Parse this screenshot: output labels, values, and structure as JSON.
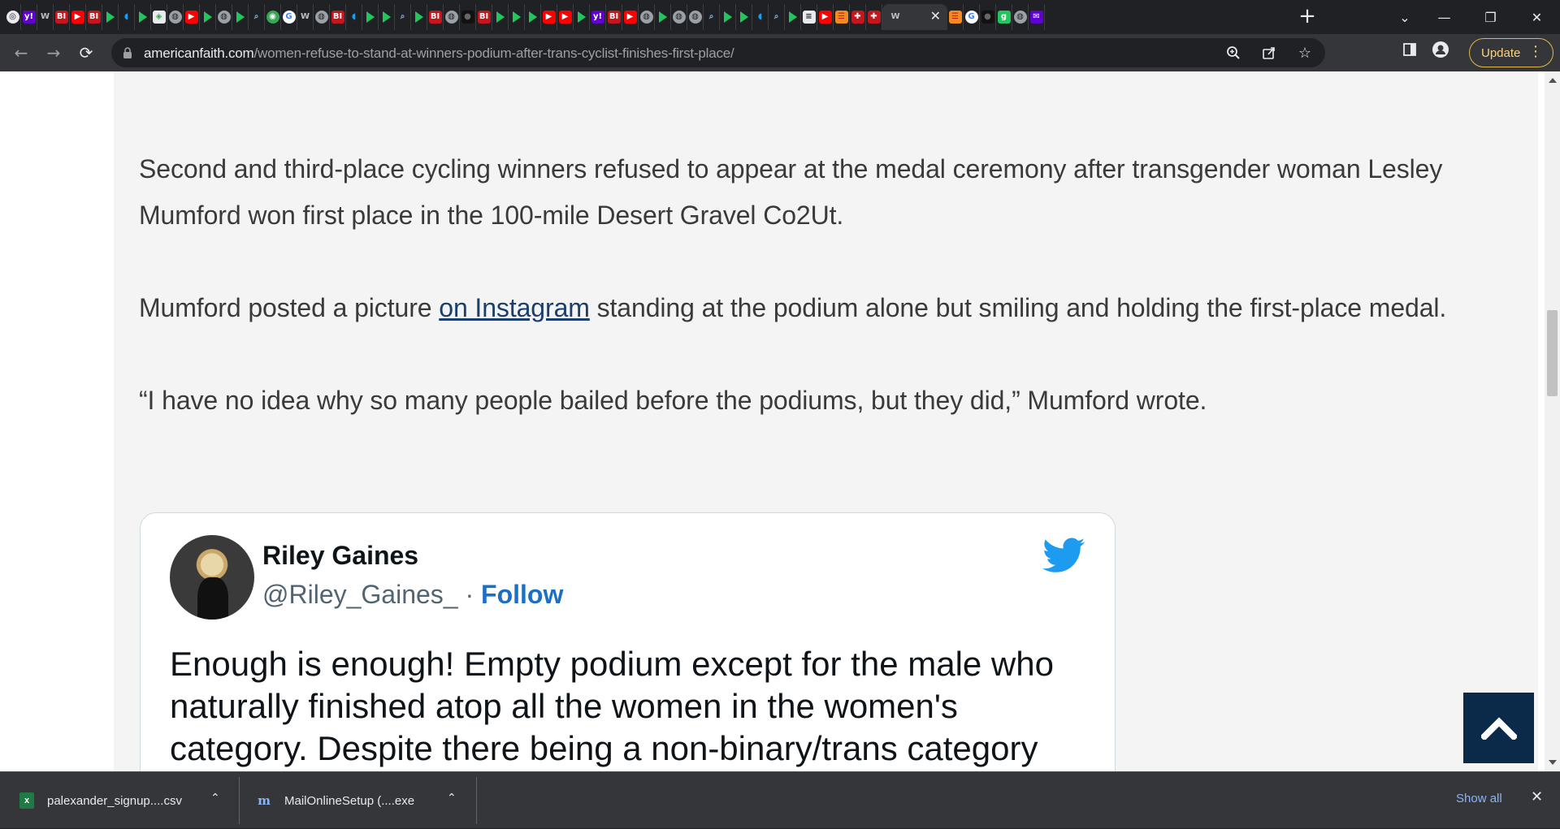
{
  "browser": {
    "tab_favicons": [
      "chrome",
      "yahoo",
      "wapo",
      "bi",
      "youtube",
      "bi",
      "rumble",
      "twitter",
      "rumble",
      "maps",
      "globe",
      "youtube",
      "rumble",
      "globe",
      "rumble",
      "search",
      "earth",
      "google",
      "wapo",
      "globe",
      "bi",
      "twitter",
      "rumble",
      "rumble",
      "search",
      "rumble",
      "bi",
      "globe",
      "dark",
      "bi",
      "rumble",
      "rumble",
      "rumble",
      "youtube",
      "youtube",
      "rumble",
      "yahoo",
      "bi",
      "youtube",
      "globe",
      "rumble",
      "globe",
      "globe",
      "search",
      "rumble",
      "rumble",
      "twitter",
      "search",
      "rumble",
      "news",
      "youtube",
      "bars",
      "gab",
      "gab",
      "bars",
      "google",
      "dark",
      "gnews",
      "globe",
      "mail"
    ],
    "active_tab": {
      "favicon": "wapo",
      "close_glyph": "✕"
    },
    "new_tab_glyph": "+",
    "window_controls": {
      "tab_search": "⌄",
      "minimize": "—",
      "restore": "❐",
      "close": "✕"
    },
    "url_domain": "americanfaith.com",
    "url_path": "/women-refuse-to-stand-at-winners-podium-after-trans-cyclist-finishes-first-place/",
    "update_label": "Update",
    "colors": {
      "chrome_bg": "#202124",
      "toolbar_bg": "#35363a",
      "update_accent": "#fcd27a"
    }
  },
  "article": {
    "paragraph_1": "Second and third-place cycling winners refused to appear at the medal ceremony after transgender woman Lesley Mumford won first place in the 100-mile Desert Gravel Co2Ut.",
    "paragraph_2_before": "Mumford posted a picture ",
    "paragraph_2_link": "on Instagram",
    "paragraph_2_after": " standing at the podium alone but smiling and holding the first-place medal.",
    "paragraph_3": "“I have no idea why so many people bailed before the podiums, but they did,” Mumford wrote."
  },
  "tweet": {
    "name": "Riley Gaines",
    "handle": "@Riley_Gaines_",
    "separator": " · ",
    "follow_label": "Follow",
    "text": "Enough is enough! Empty podium except for the male who naturally finished atop all the women in the women's category. Despite there being a non-binary/trans category",
    "brand_color": "#1d9bf0"
  },
  "downloads": {
    "items": [
      {
        "name": "palexander_signup....csv",
        "icon": "excel-icon"
      },
      {
        "name": "MailOnlineSetup (....exe",
        "icon": "mailonline-icon"
      }
    ],
    "show_all_label": "Show all"
  }
}
